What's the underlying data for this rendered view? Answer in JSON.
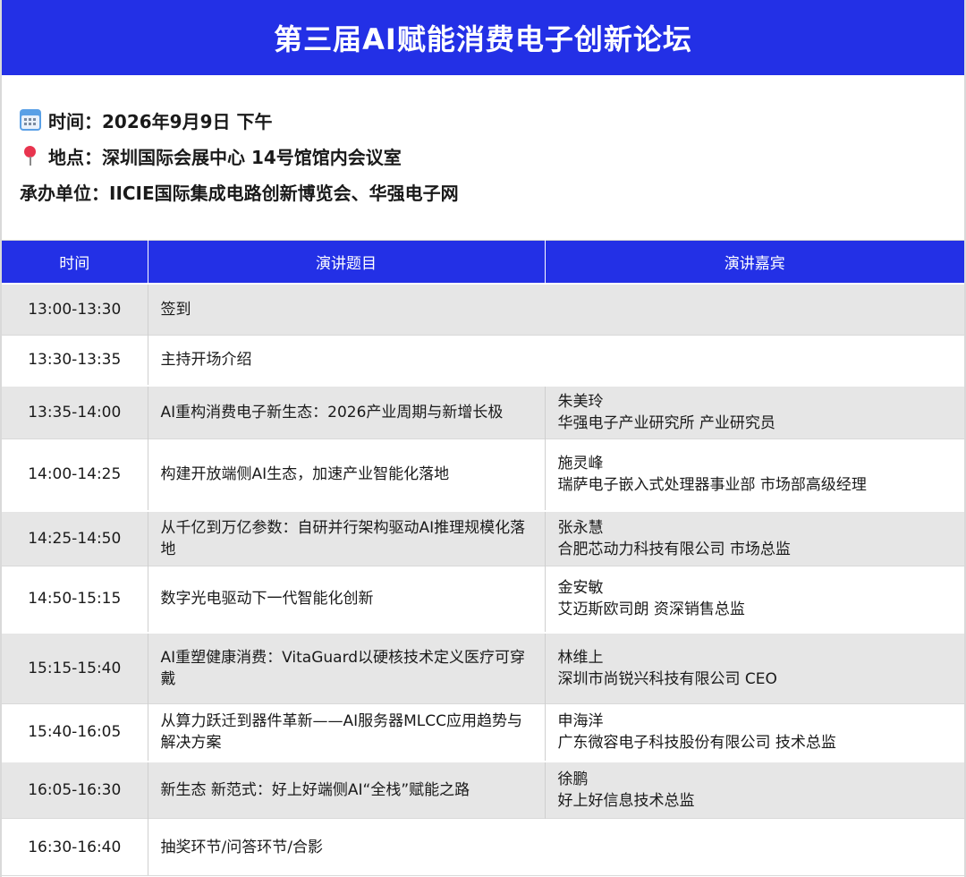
{
  "title": "第三届AI赋能消费电子创新论坛",
  "info": {
    "time_line": "时间：2026年9月9日 下午",
    "time_icon": "calendar-icon",
    "place_line": "地点：深圳国际会展中心  14号馆馆内会议室",
    "place_icon": "pushpin-icon",
    "organizer_line": "承办单位：IICIE国际集成电路创新博览会、华强电子网"
  },
  "table": {
    "headers": [
      "时间",
      "演讲题目",
      "演讲嘉宾"
    ],
    "rows": [
      {
        "time": "13:00-13:30",
        "topic": "签到",
        "speaker": "",
        "org": ""
      },
      {
        "time": "13:30-13:35",
        "topic": "主持开场介绍",
        "speaker": "",
        "org": ""
      },
      {
        "time": "13:35-14:00",
        "topic": "AI重构消费电子新生态：2026产业周期与新增长极",
        "speaker": "朱美玲",
        "org": "华强电子产业研究所 产业研究员"
      },
      {
        "time": "14:00-14:25",
        "topic": "构建开放端侧AI生态，加速产业智能化落地",
        "speaker": "施灵峰",
        "org": "瑞萨电子嵌入式处理器事业部 市场部高级经理"
      },
      {
        "time": "14:25-14:50",
        "topic": "从千亿到万亿参数：自研并行架构驱动AI推理规模化落地",
        "speaker": "张永慧",
        "org": "合肥芯动力科技有限公司 市场总监"
      },
      {
        "time": "14:50-15:15",
        "topic": "数字光电驱动下一代智能化创新",
        "speaker": "金安敏",
        "org": "艾迈斯欧司朗 资深销售总监"
      },
      {
        "time": "15:15-15:40",
        "topic": "AI重塑健康消费：VitaGuard以硬核技术定义医疗可穿戴",
        "speaker": "林维上",
        "org": "深圳市尚锐兴科技有限公司 CEO"
      },
      {
        "time": "15:40-16:05",
        "topic": "从算力跃迁到器件革新——AI服务器MLCC应用趋势与解决方案",
        "speaker": "申海洋",
        "org": "广东微容电子科技股份有限公司 技术总监"
      },
      {
        "time": "16:05-16:30",
        "topic": "新生态 新范式：好上好端侧AI“全栈”赋能之路",
        "speaker": "徐鹏",
        "org": "好上好信息技术总监"
      },
      {
        "time": "16:30-16:40",
        "topic": "抽奖环节/问答环节/合影",
        "speaker": "",
        "org": ""
      }
    ]
  }
}
